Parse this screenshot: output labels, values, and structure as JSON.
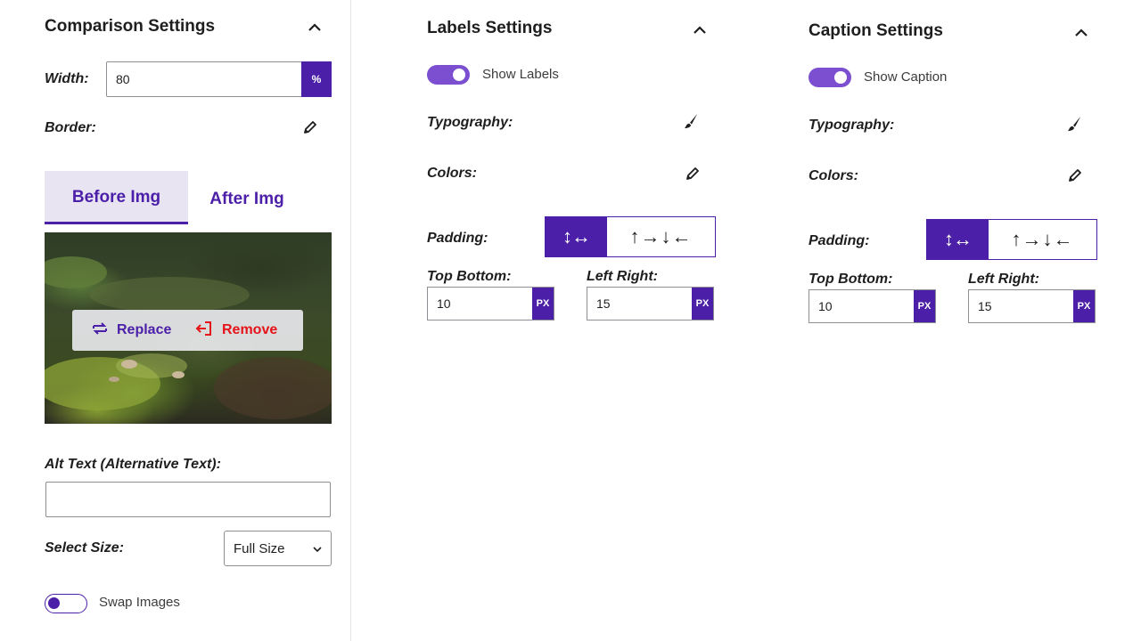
{
  "comparison": {
    "title": "Comparison Settings",
    "width_label": "Width:",
    "width_value": "80",
    "width_unit": "%",
    "border_label": "Border:",
    "tabs": [
      {
        "label": "Before Img",
        "active": true
      },
      {
        "label": "After Img",
        "active": false
      }
    ],
    "replace_label": "Replace",
    "remove_label": "Remove",
    "alt_text_label": "Alt Text (Alternative Text):",
    "alt_text_value": "",
    "select_size_label": "Select Size:",
    "select_size_value": "Full Size",
    "swap_label": "Swap Images",
    "swap_on": false
  },
  "labels": {
    "title": "Labels Settings",
    "toggle_label": "Show Labels",
    "toggle_on": true,
    "typography_label": "Typography:",
    "colors_label": "Colors:",
    "padding_label": "Padding:",
    "seg_linked": "↕↔",
    "seg_individual": "↑→↓←",
    "top_bottom_label": "Top Bottom:",
    "top_bottom_value": "10",
    "left_right_label": "Left Right:",
    "left_right_value": "15",
    "unit": "PX"
  },
  "caption": {
    "title": "Caption Settings",
    "toggle_label": "Show Caption",
    "toggle_on": true,
    "typography_label": "Typography:",
    "colors_label": "Colors:",
    "padding_label": "Padding:",
    "seg_linked": "↕↔",
    "seg_individual": "↑→↓←",
    "top_bottom_label": "Top Bottom:",
    "top_bottom_value": "10",
    "left_right_label": "Left Right:",
    "left_right_value": "15",
    "unit": "PX"
  },
  "icons": {
    "collapse": "chevron-up-icon",
    "edit": "pencil-icon",
    "style": "brush-icon",
    "replace": "swap-icon",
    "remove": "remove-icon",
    "dropdown": "chevron-down-icon"
  },
  "colors": {
    "accent": "#4b1fa8",
    "toggle": "#7b4fd0",
    "danger": "#e5131a",
    "tab_bg": "#e8e4f2"
  }
}
